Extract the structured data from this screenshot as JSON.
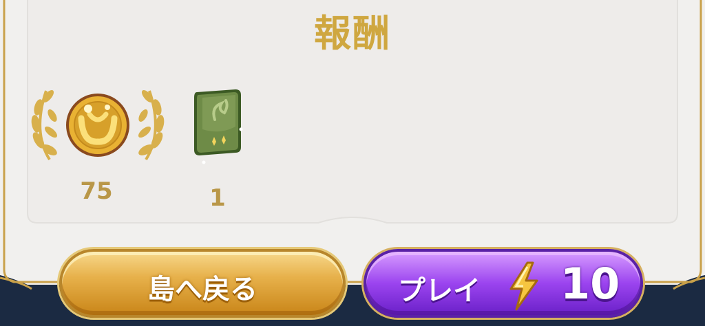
{
  "title": "報酬",
  "rewards": [
    {
      "icon": "gold-coin-icon",
      "count": "75"
    },
    {
      "icon": "green-card-pack-icon",
      "count": "1"
    }
  ],
  "buttons": {
    "back_label": "島へ戻る",
    "play_label": "プレイ",
    "play_cost": "10"
  },
  "colors": {
    "title_gold": "#cfa740",
    "count_gold": "#b99748",
    "panel": "#f0efed",
    "back_button": "#e7b14b",
    "play_button": "#9b44ef"
  }
}
